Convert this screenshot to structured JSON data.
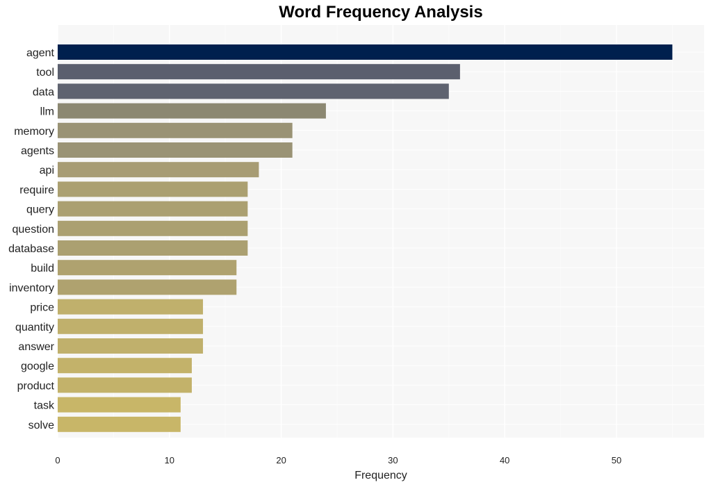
{
  "chart_data": {
    "type": "bar",
    "orientation": "horizontal",
    "title": "Word Frequency Analysis",
    "xlabel": "Frequency",
    "ylabel": "",
    "xlim": [
      0,
      58
    ],
    "xticks": [
      0,
      10,
      20,
      30,
      40,
      50
    ],
    "grid": true,
    "categories": [
      "agent",
      "tool",
      "data",
      "llm",
      "memory",
      "agents",
      "api",
      "require",
      "query",
      "question",
      "database",
      "build",
      "inventory",
      "price",
      "quantity",
      "answer",
      "google",
      "product",
      "task",
      "solve"
    ],
    "values": [
      55,
      36,
      35,
      24,
      21,
      21,
      18,
      17,
      17,
      17,
      17,
      16,
      16,
      13,
      13,
      13,
      12,
      12,
      11,
      11
    ],
    "colors": [
      "#00204e",
      "#5b5f6e",
      "#5f6370",
      "#8c8872",
      "#9a9375",
      "#9a9375",
      "#a79c74",
      "#aba071",
      "#aba071",
      "#aba071",
      "#aba071",
      "#afa26f",
      "#afa26f",
      "#c0b06c",
      "#c0b06c",
      "#c0b06c",
      "#c3b26a",
      "#c3b26a",
      "#c8b668",
      "#c8b668"
    ]
  }
}
